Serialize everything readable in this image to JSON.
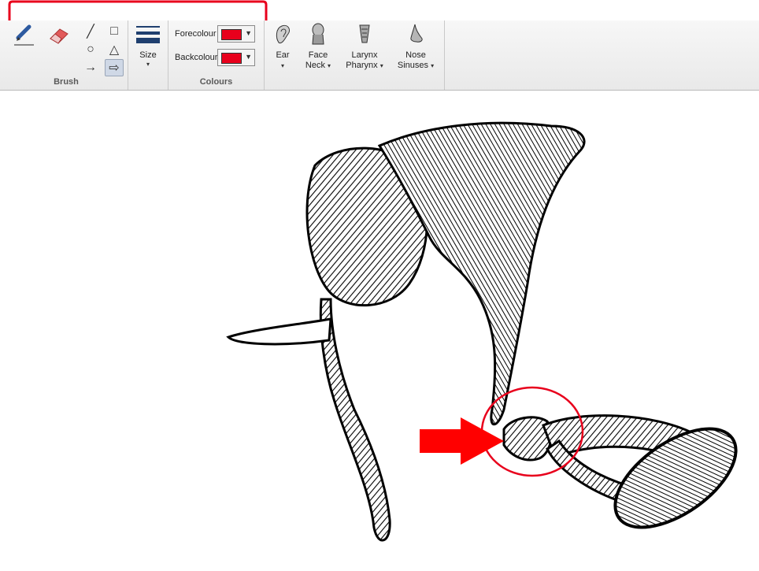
{
  "ribbon": {
    "brush": {
      "label": "Brush",
      "tools": [
        {
          "name": "pencil-icon"
        },
        {
          "name": "eraser-icon"
        }
      ],
      "shapes": [
        {
          "name": "line-shape-icon",
          "glyph": "╱"
        },
        {
          "name": "rectangle-shape-icon",
          "glyph": "□"
        },
        {
          "name": "circle-shape-icon",
          "glyph": "○"
        },
        {
          "name": "triangle-shape-icon",
          "glyph": "△"
        },
        {
          "name": "arrow-line-shape-icon",
          "glyph": "→"
        },
        {
          "name": "block-arrow-shape-icon",
          "glyph": "⇨",
          "selected": true
        }
      ]
    },
    "size": {
      "label": "Size",
      "dropdown": "▾"
    },
    "colours": {
      "label": "Colours",
      "forecolour": {
        "label": "Forecolour",
        "color": "#e8001c"
      },
      "backcolour": {
        "label": "Backcolour",
        "color": "#e8001c"
      }
    },
    "anatomy": [
      {
        "line1": "Ear",
        "line2": "",
        "icon": "ear-icon"
      },
      {
        "line1": "Face",
        "line2": "Neck",
        "icon": "face-neck-icon"
      },
      {
        "line1": "Larynx",
        "line2": "Pharynx",
        "icon": "larynx-pharynx-icon"
      },
      {
        "line1": "Nose",
        "line2": "Sinuses",
        "icon": "nose-sinuses-icon"
      }
    ]
  },
  "annotations": {
    "highlight_color": "#e8001c",
    "arrow_color": "#ff0000"
  }
}
